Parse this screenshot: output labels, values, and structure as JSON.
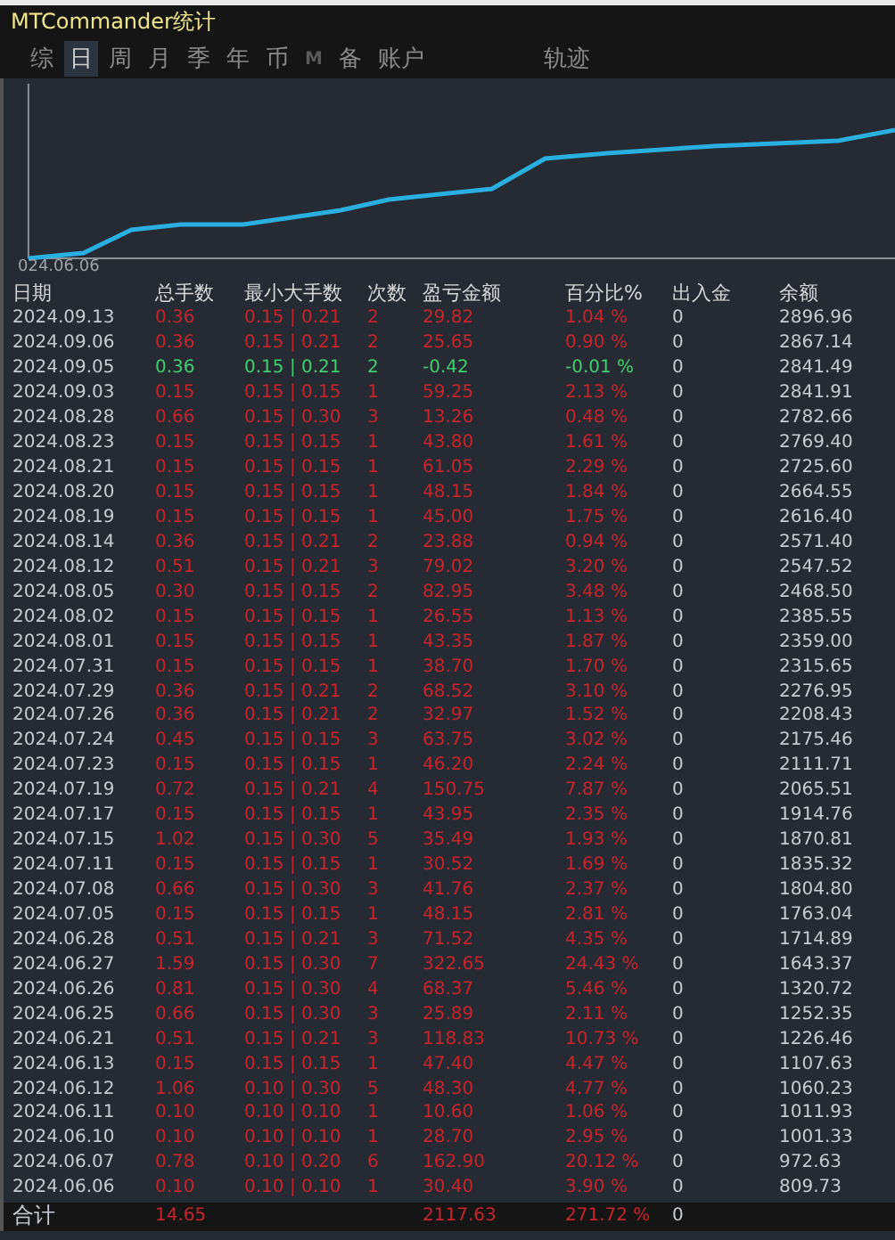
{
  "window": {
    "title": "MTCommander统计"
  },
  "tabs": [
    {
      "label": "综",
      "selected": false,
      "disabled": false
    },
    {
      "label": "日",
      "selected": true,
      "disabled": false
    },
    {
      "label": "周",
      "selected": false,
      "disabled": false
    },
    {
      "label": "月",
      "selected": false,
      "disabled": false
    },
    {
      "label": "季",
      "selected": false,
      "disabled": false
    },
    {
      "label": "年",
      "selected": false,
      "disabled": false
    },
    {
      "label": "币",
      "selected": false,
      "disabled": false
    },
    {
      "label": "M",
      "selected": false,
      "disabled": true
    },
    {
      "label": "备",
      "selected": false,
      "disabled": false
    },
    {
      "label": "账户",
      "selected": false,
      "disabled": false
    },
    {
      "label": "轨迹",
      "selected": false,
      "disabled": false
    }
  ],
  "chart": {
    "start_label": "024.06.06"
  },
  "table": {
    "columns": [
      "日期",
      "总手数",
      "最小大手数",
      "次数",
      "盈亏金额",
      "百分比%",
      "出入金",
      "余额"
    ],
    "rows": [
      {
        "kind": "gain",
        "cells": [
          "2024.09.13",
          "0.36",
          "0.15 | 0.21",
          "2",
          "29.82",
          "1.04 %",
          "0",
          "2896.96"
        ]
      },
      {
        "kind": "gain",
        "cells": [
          "2024.09.06",
          "0.36",
          "0.15 | 0.21",
          "2",
          "25.65",
          "0.90 %",
          "0",
          "2867.14"
        ]
      },
      {
        "kind": "loss",
        "cells": [
          "2024.09.05",
          "0.36",
          "0.15 | 0.21",
          "2",
          "-0.42",
          "-0.01 %",
          "0",
          "2841.49"
        ]
      },
      {
        "kind": "gain",
        "cells": [
          "2024.09.03",
          "0.15",
          "0.15 | 0.15",
          "1",
          "59.25",
          "2.13 %",
          "0",
          "2841.91"
        ]
      },
      {
        "kind": "gain",
        "cells": [
          "2024.08.28",
          "0.66",
          "0.15 | 0.30",
          "3",
          "13.26",
          "0.48 %",
          "0",
          "2782.66"
        ]
      },
      {
        "kind": "gain",
        "cells": [
          "2024.08.23",
          "0.15",
          "0.15 | 0.15",
          "1",
          "43.80",
          "1.61 %",
          "0",
          "2769.40"
        ]
      },
      {
        "kind": "gain",
        "cells": [
          "2024.08.21",
          "0.15",
          "0.15 | 0.15",
          "1",
          "61.05",
          "2.29 %",
          "0",
          "2725.60"
        ]
      },
      {
        "kind": "gain",
        "cells": [
          "2024.08.20",
          "0.15",
          "0.15 | 0.15",
          "1",
          "48.15",
          "1.84 %",
          "0",
          "2664.55"
        ]
      },
      {
        "kind": "gain",
        "cells": [
          "2024.08.19",
          "0.15",
          "0.15 | 0.15",
          "1",
          "45.00",
          "1.75 %",
          "0",
          "2616.40"
        ]
      },
      {
        "kind": "gain",
        "cells": [
          "2024.08.14",
          "0.36",
          "0.15 | 0.21",
          "2",
          "23.88",
          "0.94 %",
          "0",
          "2571.40"
        ]
      },
      {
        "kind": "gain",
        "cells": [
          "2024.08.12",
          "0.51",
          "0.15 | 0.21",
          "3",
          "79.02",
          "3.20 %",
          "0",
          "2547.52"
        ]
      },
      {
        "kind": "gain",
        "cells": [
          "2024.08.05",
          "0.30",
          "0.15 | 0.15",
          "2",
          "82.95",
          "3.48 %",
          "0",
          "2468.50"
        ]
      },
      {
        "kind": "gain",
        "cells": [
          "2024.08.02",
          "0.15",
          "0.15 | 0.15",
          "1",
          "26.55",
          "1.13 %",
          "0",
          "2385.55"
        ]
      },
      {
        "kind": "gain",
        "cells": [
          "2024.08.01",
          "0.15",
          "0.15 | 0.15",
          "1",
          "43.35",
          "1.87 %",
          "0",
          "2359.00"
        ]
      },
      {
        "kind": "gain",
        "cells": [
          "2024.07.31",
          "0.15",
          "0.15 | 0.15",
          "1",
          "38.70",
          "1.70 %",
          "0",
          "2315.65"
        ]
      },
      {
        "kind": "gain",
        "cells": [
          "2024.07.29",
          "0.36",
          "0.15 | 0.21",
          "2",
          "68.52",
          "3.10 %",
          "0",
          "2276.95"
        ]
      },
      {
        "kind": "gain",
        "cells": [
          "2024.07.26",
          "0.36",
          "0.15 | 0.21",
          "2",
          "32.97",
          "1.52 %",
          "0",
          "2208.43"
        ]
      },
      {
        "kind": "gain",
        "cells": [
          "2024.07.24",
          "0.45",
          "0.15 | 0.15",
          "3",
          "63.75",
          "3.02 %",
          "0",
          "2175.46"
        ]
      },
      {
        "kind": "gain",
        "cells": [
          "2024.07.23",
          "0.15",
          "0.15 | 0.15",
          "1",
          "46.20",
          "2.24 %",
          "0",
          "2111.71"
        ]
      },
      {
        "kind": "gain",
        "cells": [
          "2024.07.19",
          "0.72",
          "0.15 | 0.21",
          "4",
          "150.75",
          "7.87 %",
          "0",
          "2065.51"
        ]
      },
      {
        "kind": "gain",
        "cells": [
          "2024.07.17",
          "0.15",
          "0.15 | 0.15",
          "1",
          "43.95",
          "2.35 %",
          "0",
          "1914.76"
        ]
      },
      {
        "kind": "gain",
        "cells": [
          "2024.07.15",
          "1.02",
          "0.15 | 0.30",
          "5",
          "35.49",
          "1.93 %",
          "0",
          "1870.81"
        ]
      },
      {
        "kind": "gain",
        "cells": [
          "2024.07.11",
          "0.15",
          "0.15 | 0.15",
          "1",
          "30.52",
          "1.69 %",
          "0",
          "1835.32"
        ]
      },
      {
        "kind": "gain",
        "cells": [
          "2024.07.08",
          "0.66",
          "0.15 | 0.30",
          "3",
          "41.76",
          "2.37 %",
          "0",
          "1804.80"
        ]
      },
      {
        "kind": "gain",
        "cells": [
          "2024.07.05",
          "0.15",
          "0.15 | 0.15",
          "1",
          "48.15",
          "2.81 %",
          "0",
          "1763.04"
        ]
      },
      {
        "kind": "gain",
        "cells": [
          "2024.06.28",
          "0.51",
          "0.15 | 0.21",
          "3",
          "71.52",
          "4.35 %",
          "0",
          "1714.89"
        ]
      },
      {
        "kind": "gain",
        "cells": [
          "2024.06.27",
          "1.59",
          "0.15 | 0.30",
          "7",
          "322.65",
          "24.43 %",
          "0",
          "1643.37"
        ]
      },
      {
        "kind": "gain",
        "cells": [
          "2024.06.26",
          "0.81",
          "0.15 | 0.30",
          "4",
          "68.37",
          "5.46 %",
          "0",
          "1320.72"
        ]
      },
      {
        "kind": "gain",
        "cells": [
          "2024.06.25",
          "0.66",
          "0.15 | 0.30",
          "3",
          "25.89",
          "2.11 %",
          "0",
          "1252.35"
        ]
      },
      {
        "kind": "gain",
        "cells": [
          "2024.06.21",
          "0.51",
          "0.15 | 0.21",
          "3",
          "118.83",
          "10.73 %",
          "0",
          "1226.46"
        ]
      },
      {
        "kind": "gain",
        "cells": [
          "2024.06.13",
          "0.15",
          "0.15 | 0.15",
          "1",
          "47.40",
          "4.47 %",
          "0",
          "1107.63"
        ]
      },
      {
        "kind": "gain",
        "cells": [
          "2024.06.12",
          "1.06",
          "0.10 | 0.30",
          "5",
          "48.30",
          "4.77 %",
          "0",
          "1060.23"
        ]
      },
      {
        "kind": "gain",
        "cells": [
          "2024.06.11",
          "0.10",
          "0.10 | 0.10",
          "1",
          "10.60",
          "1.06 %",
          "0",
          "1011.93"
        ]
      },
      {
        "kind": "gain",
        "cells": [
          "2024.06.10",
          "0.10",
          "0.10 | 0.10",
          "1",
          "28.70",
          "2.95 %",
          "0",
          "1001.33"
        ]
      },
      {
        "kind": "gain",
        "cells": [
          "2024.06.07",
          "0.78",
          "0.10 | 0.20",
          "6",
          "162.90",
          "20.12 %",
          "0",
          "972.63"
        ]
      },
      {
        "kind": "gain",
        "cells": [
          "2024.06.06",
          "0.10",
          "0.10 | 0.10",
          "1",
          "30.40",
          "3.90 %",
          "0",
          "809.73"
        ]
      }
    ],
    "total": {
      "label": "合计",
      "lots": "14.65",
      "profit": "2117.63",
      "percent": "271.72 %",
      "deposit": "0"
    }
  }
}
